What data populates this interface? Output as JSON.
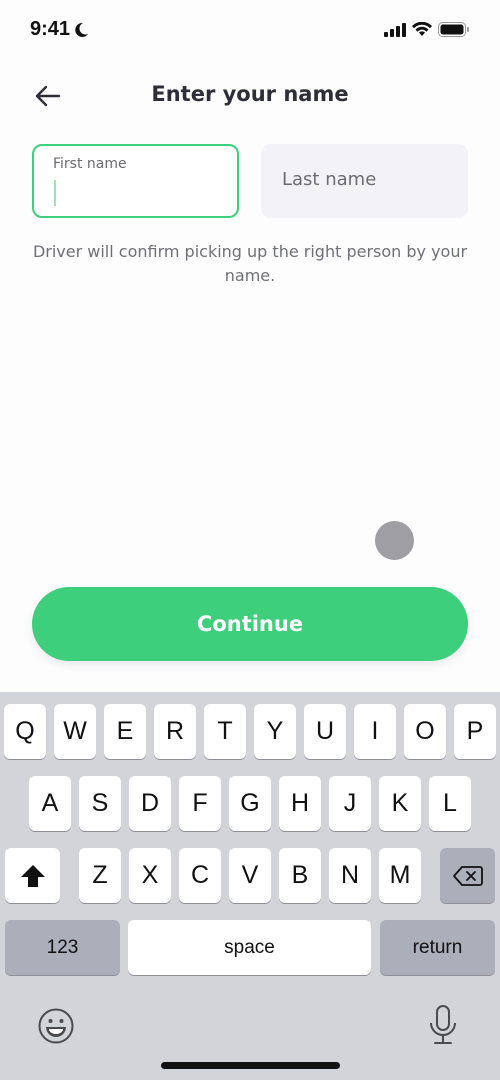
{
  "status_bar": {
    "time": "9:41",
    "focus_icon": "moon-icon",
    "signal_icon": "cellular-signal-icon",
    "wifi_icon": "wifi-icon",
    "battery_icon": "battery-icon"
  },
  "header": {
    "title": "Enter your name",
    "back_icon": "arrow-left-icon"
  },
  "form": {
    "first_name": {
      "label": "First name",
      "value": ""
    },
    "last_name": {
      "placeholder": "Last name",
      "value": ""
    },
    "helper_text": "Driver will confirm picking up the right person by your name."
  },
  "actions": {
    "continue_label": "Continue"
  },
  "colors": {
    "accent": "#3ecf7c",
    "field_bg": "#f3f2f6",
    "keyboard_bg": "#d3d4da"
  },
  "keyboard": {
    "row1": [
      "Q",
      "W",
      "E",
      "R",
      "T",
      "Y",
      "U",
      "I",
      "O",
      "P"
    ],
    "row2": [
      "A",
      "S",
      "D",
      "F",
      "G",
      "H",
      "J",
      "K",
      "L"
    ],
    "row3": [
      "Z",
      "X",
      "C",
      "V",
      "B",
      "N",
      "M"
    ],
    "numbers_label": "123",
    "space_label": "space",
    "return_label": "return",
    "shift_icon": "shift-icon",
    "delete_icon": "delete-backspace-icon",
    "emoji_icon": "emoji-icon",
    "mic_icon": "microphone-icon"
  }
}
